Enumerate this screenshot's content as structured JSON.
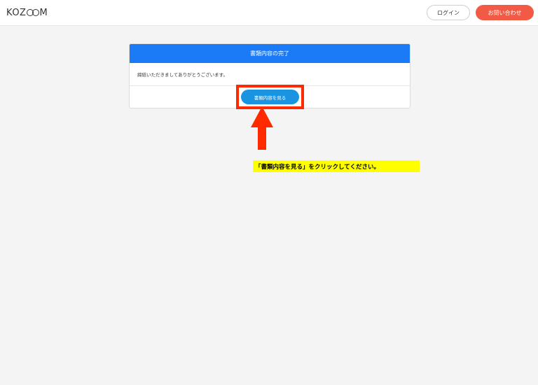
{
  "header": {
    "logo_left": "KOZ",
    "logo_right": "M",
    "login_label": "ログイン",
    "contact_label": "お問い合わせ"
  },
  "card": {
    "title": "書類内容の完了",
    "message": "締結いただきましてありがとうございます。",
    "view_button_label": "書類内容を見る"
  },
  "annotation": {
    "instruction": "「書類内容を見る」をクリックしてください。",
    "highlight_color": "#ff2a00",
    "instruction_bg": "#ffff00"
  },
  "colors": {
    "card_header": "#1b7bf7",
    "view_button": "#1a94e0",
    "contact_button": "#f25a45"
  }
}
